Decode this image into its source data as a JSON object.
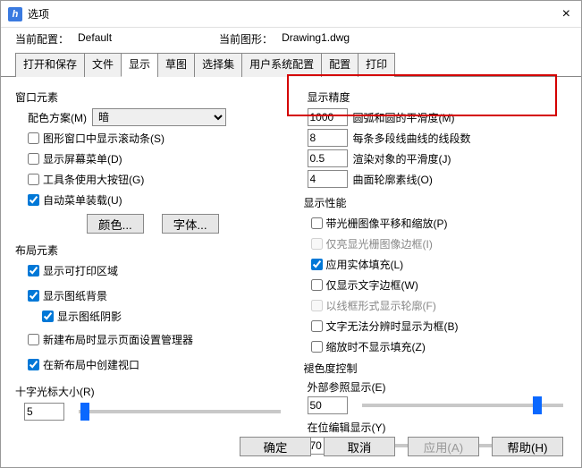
{
  "window": {
    "title": "选项",
    "close": "×",
    "icon": "h"
  },
  "header": {
    "config_label": "当前配置：",
    "config_value": "Default",
    "drawing_label": "当前图形：",
    "drawing_value": "Drawing1.dwg"
  },
  "tabs": [
    "打开和保存",
    "文件",
    "显示",
    "草图",
    "选择集",
    "用户系统配置",
    "配置",
    "打印"
  ],
  "active_tab": 2,
  "left": {
    "window_elements": "窗口元素",
    "colorscheme_label": "配色方案(M)",
    "colorscheme_value": "暗",
    "cb_scrollbar": "图形窗口中显示滚动条(S)",
    "cb_screenmenu": "显示屏幕菜单(D)",
    "cb_largebuttons": "工具条使用大按钮(G)",
    "cb_autoload": "自动菜单装载(U)",
    "btn_color": "颜色...",
    "btn_font": "字体...",
    "layout_elements": "布局元素",
    "cb_printable": "显示可打印区域",
    "cb_paperbg": "显示图纸背景",
    "cb_papershadow": "显示图纸阴影",
    "cb_pagesetup": "新建布局时显示页面设置管理器",
    "cb_viewport": "在新布局中创建视口",
    "crosshair_label": "十字光标大小(R)",
    "crosshair_value": "5"
  },
  "right": {
    "precision_title": "显示精度",
    "p1": {
      "val": "1000",
      "lbl": "圆弧和圆的平滑度(M)"
    },
    "p2": {
      "val": "8",
      "lbl": "每条多段线曲线的线段数"
    },
    "p3": {
      "val": "0.5",
      "lbl": "渲染对象的平滑度(J)"
    },
    "p4": {
      "val": "4",
      "lbl": "曲面轮廓素线(O)"
    },
    "perf_title": "显示性能",
    "cb_raster": "带光栅图像平移和缩放(P)",
    "cb_highlight": "仅亮显光栅图像边框(I)",
    "cb_solidfill": "应用实体填充(L)",
    "cb_textframe": "仅显示文字边框(W)",
    "cb_wireframe": "以线框形式显示轮廓(F)",
    "cb_truetype": "文字无法分辨时显示为框(B)",
    "cb_zoomfill": "缩放时不显示填充(Z)",
    "fade_title": "褪色度控制",
    "xref_label": "外部参照显示(E)",
    "xref_value": "50",
    "inplace_label": "在位编辑显示(Y)",
    "inplace_value": "70"
  },
  "footer": {
    "ok": "确定",
    "cancel": "取消",
    "apply": "应用(A)",
    "help": "帮助(H)"
  }
}
